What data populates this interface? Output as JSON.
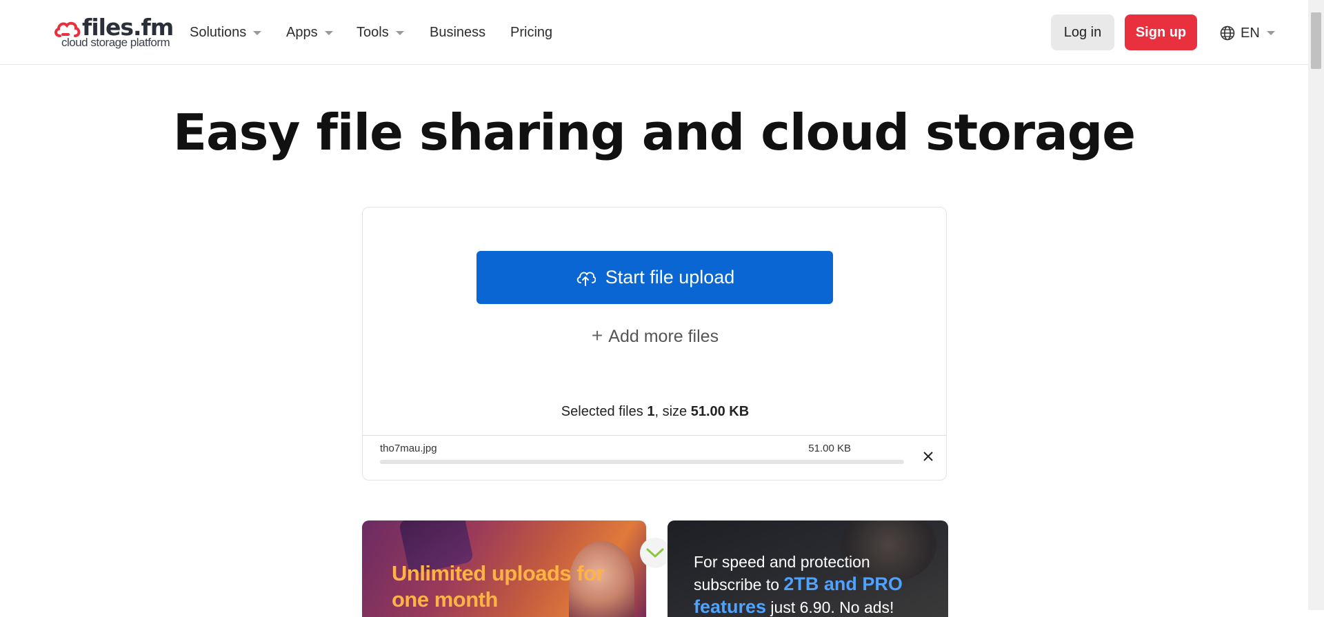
{
  "brand": {
    "name": "files.fm",
    "tagline": "cloud storage platform",
    "accent": "#e8303f"
  },
  "nav": {
    "items": [
      {
        "label": "Solutions",
        "dropdown": true
      },
      {
        "label": "Apps",
        "dropdown": true
      },
      {
        "label": "Tools",
        "dropdown": true
      },
      {
        "label": "Business",
        "dropdown": false
      },
      {
        "label": "Pricing",
        "dropdown": false
      }
    ],
    "login": "Log in",
    "signup": "Sign up",
    "language": "EN"
  },
  "hero": {
    "title": "Easy file sharing and cloud storage"
  },
  "upload": {
    "start_label": "Start file upload",
    "add_more_label": "Add more files",
    "summary": {
      "prefix": "Selected files",
      "count": "1",
      "size_prefix": ", size",
      "size": "51.00 KB"
    },
    "files": [
      {
        "name": "tho7mau.jpg",
        "size": "51.00 KB",
        "progress": 0
      }
    ],
    "button_color": "#0a66d3"
  },
  "promos": {
    "left": {
      "text": "Unlimited uploads for one month"
    },
    "right": {
      "text_a": "For speed and protection subscribe to ",
      "highlight": "2TB and PRO features",
      "text_b": " just 6.90. No ads!"
    }
  }
}
